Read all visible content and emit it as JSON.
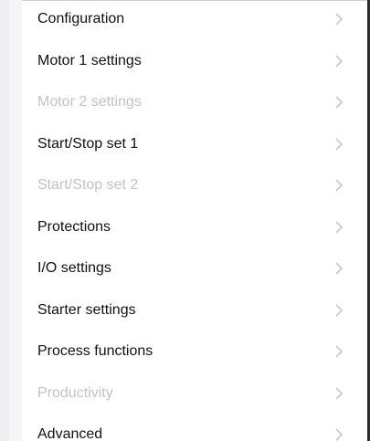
{
  "menu": {
    "items": [
      {
        "label": "Configuration",
        "enabled": true
      },
      {
        "label": "Motor 1 settings",
        "enabled": true
      },
      {
        "label": "Motor 2 settings",
        "enabled": false
      },
      {
        "label": "Start/Stop set 1",
        "enabled": true
      },
      {
        "label": "Start/Stop set 2",
        "enabled": false
      },
      {
        "label": "Protections",
        "enabled": true
      },
      {
        "label": "I/O settings",
        "enabled": true
      },
      {
        "label": "Starter settings",
        "enabled": true
      },
      {
        "label": "Process functions",
        "enabled": true
      },
      {
        "label": "Productivity",
        "enabled": false
      },
      {
        "label": "Advanced",
        "enabled": true
      }
    ],
    "chevron_icon": "chevron-right-icon"
  },
  "colors": {
    "text_enabled": "#111111",
    "text_disabled": "#c3c3c7",
    "chevron": "#c7c7cc",
    "background": "#ffffff"
  }
}
